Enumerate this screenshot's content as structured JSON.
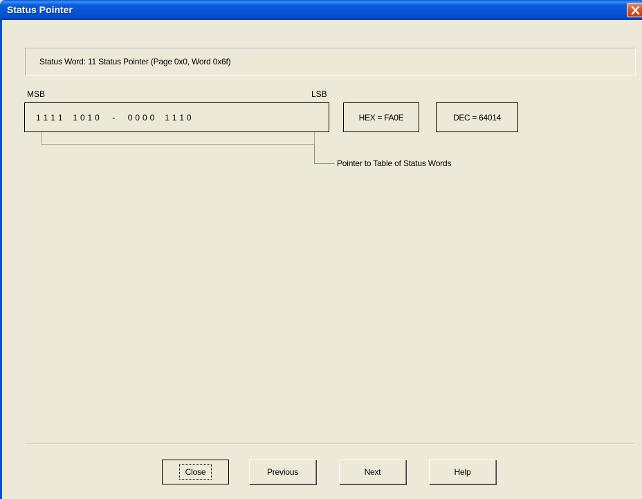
{
  "window": {
    "title": "Status Pointer"
  },
  "info": {
    "text": "Status Word: 11   Status Pointer  (Page 0x0, Word 0x6f)"
  },
  "register": {
    "msb_label": "MSB",
    "lsb_label": "LSB",
    "bits": "1 1 1 1    1 0 1 0     -     0 0 0 0    1 1 1 0",
    "hex": "HEX =  FA0E",
    "dec": "DEC = 64014",
    "field_label": "Pointer to Table of Status Words"
  },
  "buttons": {
    "close": "Close",
    "previous": "Previous",
    "next": "Next",
    "help": "Help"
  }
}
